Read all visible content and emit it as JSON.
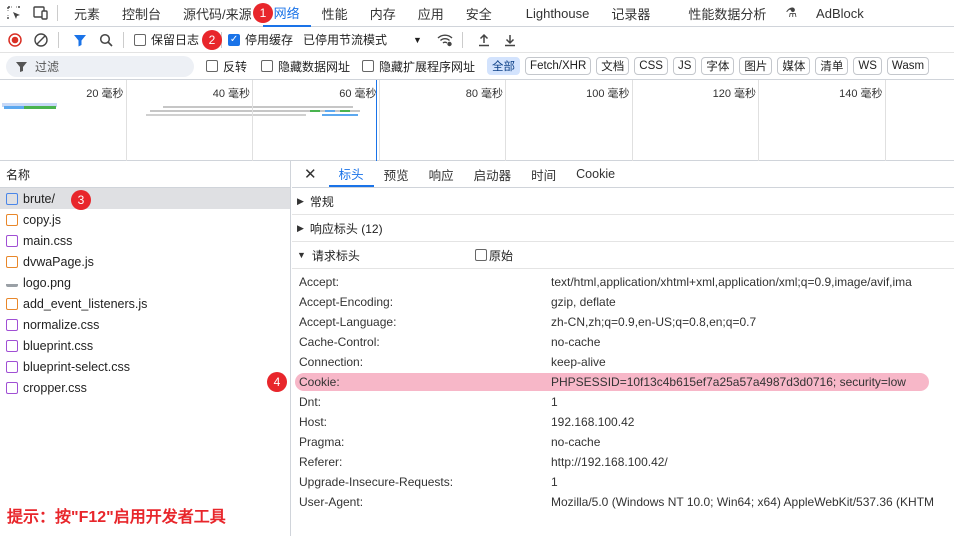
{
  "top_tabs": [
    "元素",
    "控制台",
    "源代码/来源",
    "网络",
    "性能",
    "内存",
    "应用",
    "安全",
    "Lighthouse",
    "记录器",
    "性能数据分析",
    "AdBlock"
  ],
  "toolbar": {
    "preserve_log": "保留日志",
    "disable_cache": "停用缓存",
    "throttle": "已停用节流模式"
  },
  "filter": {
    "placeholder": "过滤",
    "invert": "反转",
    "hide_data_urls": "隐藏数据网址",
    "hide_ext_urls": "隐藏扩展程序网址",
    "types": [
      "全部",
      "Fetch/XHR",
      "文档",
      "CSS",
      "JS",
      "字体",
      "图片",
      "媒体",
      "清单",
      "WS",
      "Wasm"
    ]
  },
  "timeline_labels": [
    "20 毫秒",
    "40 毫秒",
    "60 毫秒",
    "80 毫秒",
    "100 毫秒",
    "120 毫秒",
    "140 毫秒"
  ],
  "list": {
    "header": "名称",
    "items": [
      {
        "name": "brute/",
        "type": "doc"
      },
      {
        "name": "copy.js",
        "type": "js"
      },
      {
        "name": "main.css",
        "type": "css"
      },
      {
        "name": "dvwaPage.js",
        "type": "js"
      },
      {
        "name": "logo.png",
        "type": "img"
      },
      {
        "name": "add_event_listeners.js",
        "type": "js"
      },
      {
        "name": "normalize.css",
        "type": "css"
      },
      {
        "name": "blueprint.css",
        "type": "css"
      },
      {
        "name": "blueprint-select.css",
        "type": "css"
      },
      {
        "name": "cropper.css",
        "type": "css"
      }
    ]
  },
  "detail": {
    "tabs": [
      "标头",
      "预览",
      "响应",
      "启动器",
      "时间",
      "Cookie"
    ],
    "general": "常规",
    "response_headers": "响应标头 (12)",
    "request_headers": "请求标头",
    "raw": "原始",
    "headers": [
      {
        "k": "Accept:",
        "v": "text/html,application/xhtml+xml,application/xml;q=0.9,image/avif,ima"
      },
      {
        "k": "Accept-Encoding:",
        "v": "gzip, deflate"
      },
      {
        "k": "Accept-Language:",
        "v": "zh-CN,zh;q=0.9,en-US;q=0.8,en;q=0.7"
      },
      {
        "k": "Cache-Control:",
        "v": "no-cache"
      },
      {
        "k": "Connection:",
        "v": "keep-alive"
      },
      {
        "k": "Cookie:",
        "v": "PHPSESSID=10f13c4b615ef7a25a57a4987d3d0716; security=low"
      },
      {
        "k": "Dnt:",
        "v": "1"
      },
      {
        "k": "Host:",
        "v": "192.168.100.42"
      },
      {
        "k": "Pragma:",
        "v": "no-cache"
      },
      {
        "k": "Referer:",
        "v": "http://192.168.100.42/"
      },
      {
        "k": "Upgrade-Insecure-Requests:",
        "v": "1"
      },
      {
        "k": "User-Agent:",
        "v": "Mozilla/5.0 (Windows NT 10.0; Win64; x64) AppleWebKit/537.36 (KHTM"
      }
    ]
  },
  "badges": [
    "1",
    "2",
    "3",
    "4"
  ],
  "hint": "提示：按\"F12\"启用开发者工具",
  "colors": {
    "accent": "#1a73e8",
    "badge": "#e8262b",
    "highlight": "#f7b7c8"
  }
}
